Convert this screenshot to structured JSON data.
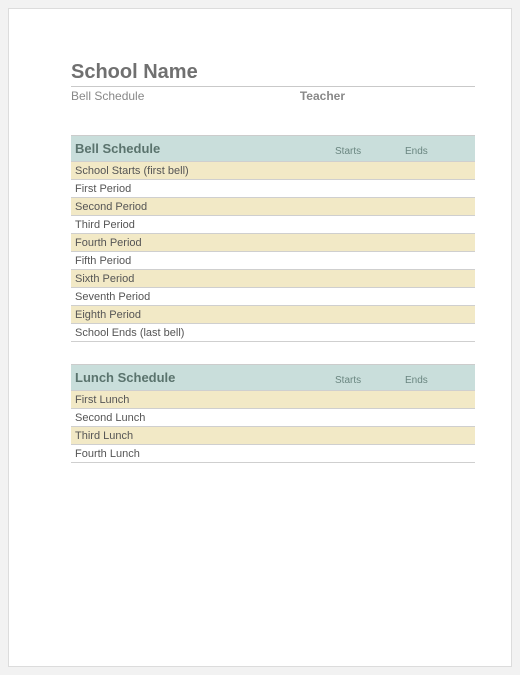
{
  "header": {
    "title": "School Name",
    "subtitle": "Bell Schedule",
    "teacher_label": "Teacher"
  },
  "bell": {
    "title": "Bell Schedule",
    "starts": "Starts",
    "ends": "Ends",
    "rows": [
      "School Starts (first bell)",
      "First Period",
      "Second Period",
      "Third Period",
      "Fourth Period",
      "Fifth Period",
      "Sixth Period",
      "Seventh Period",
      "Eighth Period",
      "School Ends (last bell)"
    ]
  },
  "lunch": {
    "title": "Lunch Schedule",
    "starts": "Starts",
    "ends": "Ends",
    "rows": [
      "First Lunch",
      "Second Lunch",
      "Third Lunch",
      "Fourth Lunch"
    ]
  }
}
